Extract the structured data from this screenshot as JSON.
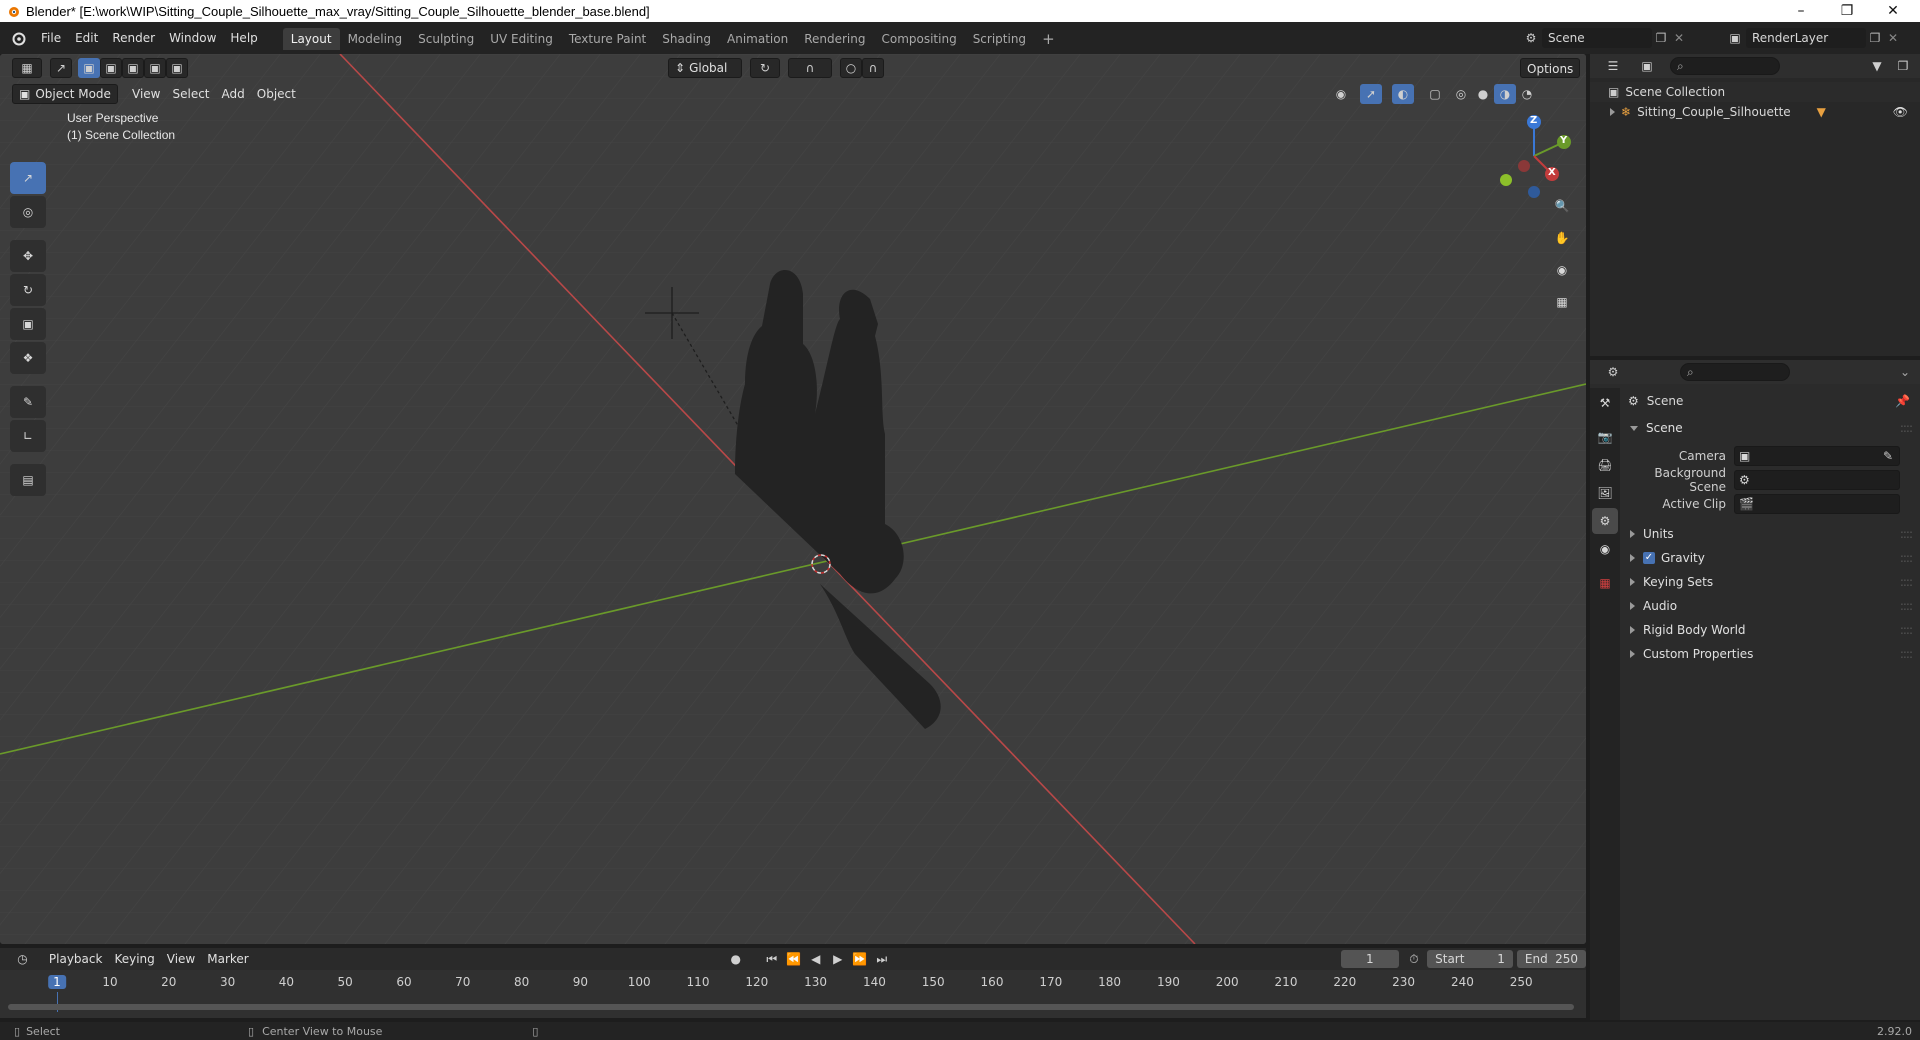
{
  "window": {
    "title": "Blender* [E:\\work\\WIP\\Sitting_Couple_Silhouette_max_vray/Sitting_Couple_Silhouette_blender_base.blend]"
  },
  "menu": [
    "File",
    "Edit",
    "Render",
    "Window",
    "Help"
  ],
  "workspaces": [
    "Layout",
    "Modeling",
    "Sculpting",
    "UV Editing",
    "Texture Paint",
    "Shading",
    "Animation",
    "Rendering",
    "Compositing",
    "Scripting"
  ],
  "scene_selector": {
    "scene": "Scene",
    "view_layer": "RenderLayer"
  },
  "viewport": {
    "mode": "Object Mode",
    "menus": [
      "View",
      "Select",
      "Add",
      "Object"
    ],
    "orientation": "Global",
    "options_label": "Options",
    "overlay_line1": "User Perspective",
    "overlay_line2": "(1) Scene Collection",
    "gizmo": {
      "z": "Z",
      "y": "Y",
      "x": "X"
    }
  },
  "timeline": {
    "menus": [
      "Playback",
      "Keying",
      "View",
      "Marker"
    ],
    "current_frame": "1",
    "start_label": "Start",
    "start": "1",
    "end_label": "End",
    "end": "250",
    "ticks": [
      "1",
      "10",
      "20",
      "30",
      "40",
      "50",
      "60",
      "70",
      "80",
      "90",
      "100",
      "110",
      "120",
      "130",
      "140",
      "150",
      "160",
      "170",
      "180",
      "190",
      "200",
      "210",
      "220",
      "230",
      "240",
      "250"
    ]
  },
  "statusbar": {
    "left": "Select",
    "middle": "Center View to Mouse",
    "version": "2.92.0"
  },
  "outliner": {
    "collection": "Scene Collection",
    "object": "Sitting_Couple_Silhouette"
  },
  "properties": {
    "context": "Scene",
    "panel_scene": "Scene",
    "camera_label": "Camera",
    "background_label": "Background Scene",
    "clip_label": "Active Clip",
    "panels": [
      "Units",
      "Gravity",
      "Keying Sets",
      "Audio",
      "Rigid Body World",
      "Custom Properties"
    ]
  },
  "colors": {
    "accent": "#4772b3",
    "x_axis": "#c23c3c",
    "y_axis": "#6a9a2a",
    "z_axis": "#3a78d6"
  }
}
